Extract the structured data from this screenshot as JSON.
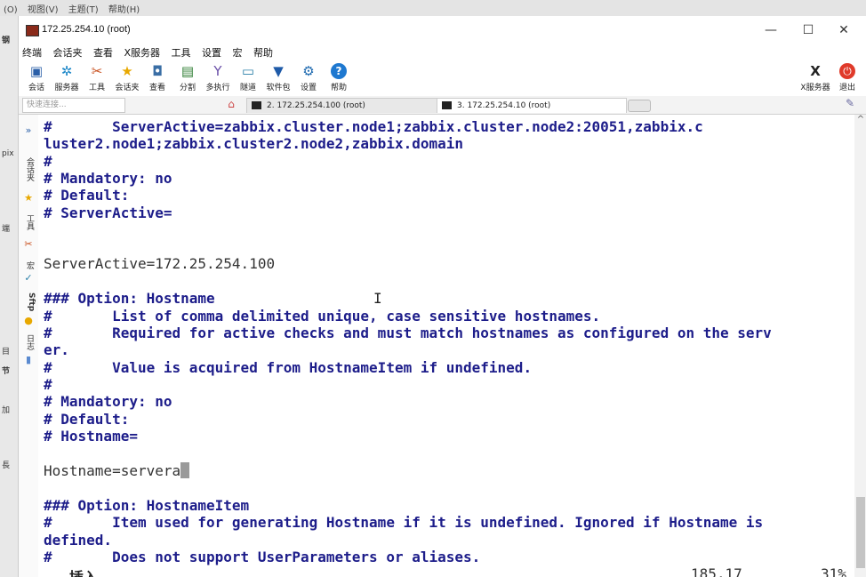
{
  "outer_menu": [
    "(O)",
    "视图(V)",
    "主题(T)",
    "帮助(H)"
  ],
  "outer_left": [
    "钢",
    "pix",
    "端",
    "目",
    "节",
    "加",
    "長"
  ],
  "window": {
    "title": "172.25.254.10 (root)",
    "controls": {
      "minimize": "—",
      "maximize": "☐",
      "close": "✕"
    }
  },
  "menu": [
    "终端",
    "会话夹",
    "查看",
    "X服务器",
    "工具",
    "设置",
    "宏",
    "帮助"
  ],
  "toolbar": [
    {
      "label": "会话",
      "icon": "session-icon"
    },
    {
      "label": "服务器",
      "icon": "servers-icon"
    },
    {
      "label": "工具",
      "icon": "tools-icon"
    },
    {
      "label": "会话夹",
      "icon": "star-icon"
    },
    {
      "label": "查看",
      "icon": "view-icon"
    },
    {
      "label": "分割",
      "icon": "split-icon"
    },
    {
      "label": "多执行",
      "icon": "multiexec-icon"
    },
    {
      "label": "隧道",
      "icon": "tunnel-icon"
    },
    {
      "label": "软件包",
      "icon": "packages-icon"
    },
    {
      "label": "设置",
      "icon": "settings-icon"
    },
    {
      "label": "帮助",
      "icon": "help-icon"
    }
  ],
  "toolbar_right": [
    {
      "label": "X服务器",
      "icon": "xserver-icon"
    },
    {
      "label": "退出",
      "icon": "power-icon"
    }
  ],
  "quick_connect_placeholder": "快速连接...",
  "tabs": [
    {
      "label": "2. 172.25.254.100 (root)",
      "active": false
    },
    {
      "label": "3. 172.25.254.10 (root)",
      "active": true
    }
  ],
  "sidebar": [
    "会话夹",
    "工具",
    "宏",
    "Sftp",
    "日志"
  ],
  "terminal": {
    "lines": [
      "#       ServerActive=zabbix.cluster.node1;zabbix.cluster.node2:20051,zabbix.c",
      "luster2.node1;zabbix.cluster2.node2,zabbix.domain",
      "#",
      "# Mandatory: no",
      "# Default:",
      "# ServerActive=",
      "",
      "ServerActive=172.25.254.100",
      "",
      "### Option: Hostname",
      "#       List of comma delimited unique, case sensitive hostnames.",
      "#       Required for active checks and must match hostnames as configured on the serv",
      "er.",
      "#       Value is acquired from HostnameItem if undefined.",
      "#",
      "# Mandatory: no",
      "# Default:",
      "# Hostname=",
      "",
      "Hostname=servera",
      "",
      "### Option: HostnameItem",
      "#       Item used for generating Hostname if it is undefined. Ignored if Hostname is",
      "defined.",
      "#       Does not support UserParameters or aliases."
    ],
    "status_mode": "-- 插入 --",
    "status_pos": "185,17",
    "status_pct": "31%"
  }
}
